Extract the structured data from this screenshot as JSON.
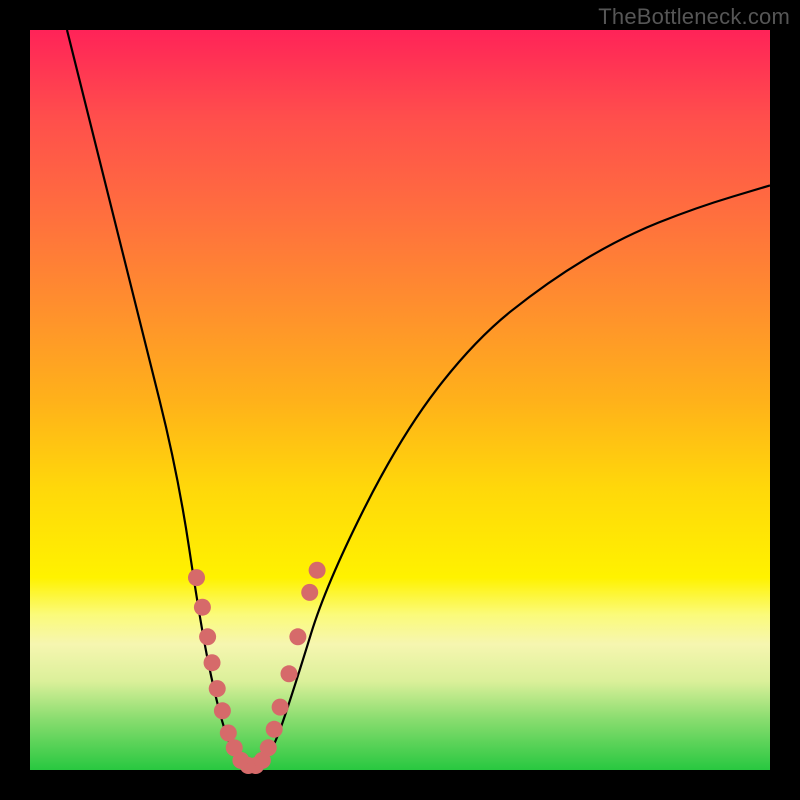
{
  "watermark": "TheBottleneck.com",
  "chart_data": {
    "type": "line",
    "title": "",
    "xlabel": "",
    "ylabel": "",
    "xlim": [
      0,
      100
    ],
    "ylim": [
      0,
      100
    ],
    "curve_approx_points": [
      [
        5,
        100
      ],
      [
        10,
        80
      ],
      [
        15,
        60
      ],
      [
        20,
        40
      ],
      [
        23,
        20
      ],
      [
        25,
        10
      ],
      [
        27,
        3
      ],
      [
        29,
        0.5
      ],
      [
        31,
        0.5
      ],
      [
        33,
        3
      ],
      [
        36,
        12
      ],
      [
        40,
        25
      ],
      [
        50,
        45
      ],
      [
        60,
        58
      ],
      [
        70,
        66
      ],
      [
        80,
        72
      ],
      [
        90,
        76
      ],
      [
        100,
        79
      ]
    ],
    "markers_approx": [
      [
        22.5,
        26
      ],
      [
        23.3,
        22
      ],
      [
        24.0,
        18
      ],
      [
        24.6,
        14.5
      ],
      [
        25.3,
        11
      ],
      [
        26.0,
        8
      ],
      [
        26.8,
        5
      ],
      [
        27.6,
        3
      ],
      [
        28.5,
        1.3
      ],
      [
        29.5,
        0.6
      ],
      [
        30.5,
        0.6
      ],
      [
        31.4,
        1.3
      ],
      [
        32.2,
        3
      ],
      [
        33.0,
        5.5
      ],
      [
        33.8,
        8.5
      ],
      [
        35.0,
        13
      ],
      [
        36.2,
        18
      ],
      [
        37.8,
        24
      ],
      [
        38.8,
        27
      ]
    ],
    "colors": {
      "gradient_top": "#ff2358",
      "gradient_bottom": "#28c840",
      "curve": "#000000",
      "marker": "#d66a6a",
      "frame": "#000000"
    }
  }
}
